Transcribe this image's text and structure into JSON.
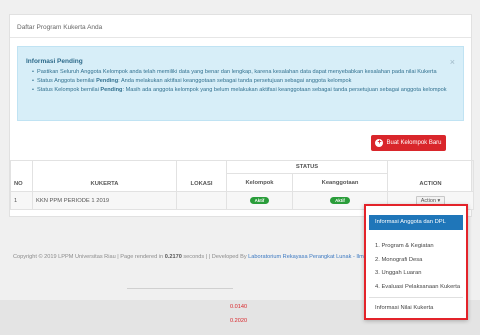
{
  "panel": {
    "title": "Daftar Program Kukerta Anda"
  },
  "alert": {
    "title": "Informasi Pending",
    "close": "×",
    "items": [
      {
        "pre": "Pastikan Seluruh Anggota Kelompok anda telah memiliki data yang benar dan lengkap, karena kesalahan data dapat menyebabkan kesalahan pada nilai Kukerta",
        "bold": "",
        "post": ""
      },
      {
        "pre": "Status Anggota bernilai ",
        "bold": "Pending",
        "post": ": Anda melakukan aktifasi keanggotaan sebagai tanda persetujuan sebagai anggota kelompok"
      },
      {
        "pre": "Status Kelompok bernilai ",
        "bold": "Pending",
        "post": ": Masih ada anggota kelompok yang belum melakukan aktifasi keanggotaan sebagai tanda persetujuan sebagai anggota kelompok"
      }
    ]
  },
  "new_group_button": "Buat Kelompok Baru",
  "table": {
    "headers": {
      "no": "NO",
      "kukerta": "KUKERTA",
      "lokasi": "LOKASI",
      "status": "STATUS",
      "kelompok": "Kelompok",
      "keanggotaan": "Keanggotaan",
      "action": "ACTION"
    },
    "rows": [
      {
        "no": "1",
        "kukerta": "KKN PPM PERIODE 1 2019",
        "lokasi": "",
        "kelompok": "Aktif",
        "keanggotaan": "Aktif",
        "action": "Action ▾"
      }
    ]
  },
  "footer": {
    "pre": "Copyright © 2019 LPPM Universitas Riau | Page rendered in ",
    "time": "0.2170",
    "mid": " seconds | | Developed By ",
    "lab": "Laboratorium Rekayasa Perangkat Lunak - Ilmu Komputer Un..."
  },
  "status_values": [
    "0.0140",
    "0.2020"
  ],
  "dropdown": {
    "header": "Informasi Anggota dan DPL",
    "items": [
      "1. Program & Kegiatan",
      "2. Monografi Desa",
      "3. Unggah Luaran",
      "4. Evaluasi Pelaksanaan Kukerta"
    ],
    "footer_item": "Informasi Nilai Kukerta"
  },
  "colors": {
    "accent_red": "#d9262b",
    "primary_blue": "#1f76b9",
    "success_green": "#2a9d3a"
  }
}
